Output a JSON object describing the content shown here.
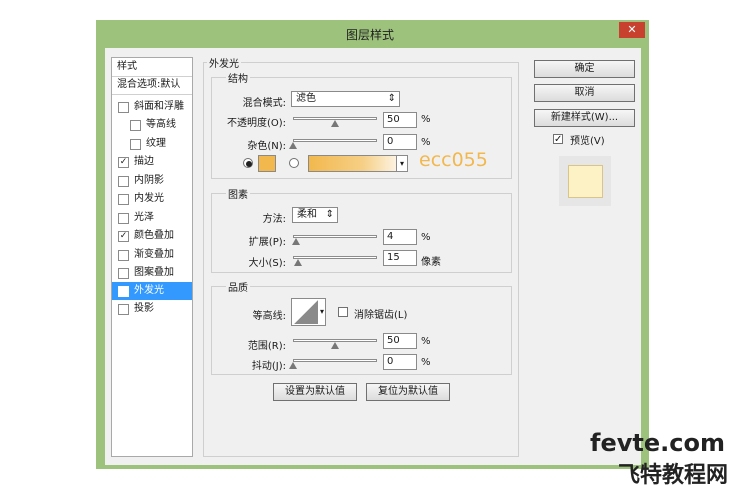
{
  "window": {
    "title": "图层样式",
    "close_glyph": "✕"
  },
  "styles_panel": {
    "header": "样式",
    "items": [
      {
        "label": "混合选项:默认",
        "has_checkbox": false,
        "checked": false,
        "indent": false,
        "selected": false
      },
      {
        "label": "斜面和浮雕",
        "has_checkbox": true,
        "checked": false,
        "indent": false,
        "selected": false
      },
      {
        "label": "等高线",
        "has_checkbox": true,
        "checked": false,
        "indent": true,
        "selected": false
      },
      {
        "label": "纹理",
        "has_checkbox": true,
        "checked": false,
        "indent": true,
        "selected": false
      },
      {
        "label": "描边",
        "has_checkbox": true,
        "checked": true,
        "indent": false,
        "selected": false
      },
      {
        "label": "内阴影",
        "has_checkbox": true,
        "checked": false,
        "indent": false,
        "selected": false
      },
      {
        "label": "内发光",
        "has_checkbox": true,
        "checked": false,
        "indent": false,
        "selected": false
      },
      {
        "label": "光泽",
        "has_checkbox": true,
        "checked": false,
        "indent": false,
        "selected": false
      },
      {
        "label": "颜色叠加",
        "has_checkbox": true,
        "checked": true,
        "indent": false,
        "selected": false
      },
      {
        "label": "渐变叠加",
        "has_checkbox": true,
        "checked": false,
        "indent": false,
        "selected": false
      },
      {
        "label": "图案叠加",
        "has_checkbox": true,
        "checked": false,
        "indent": false,
        "selected": false
      },
      {
        "label": "外发光",
        "has_checkbox": true,
        "checked": true,
        "indent": false,
        "selected": true
      },
      {
        "label": "投影",
        "has_checkbox": true,
        "checked": false,
        "indent": false,
        "selected": false
      }
    ]
  },
  "outer_glow": {
    "section_title": "外发光",
    "structure": {
      "title": "结构",
      "blend_mode_label": "混合模式:",
      "blend_mode_value": "滤色",
      "opacity_label": "不透明度(O):",
      "opacity_value": "50",
      "opacity_level": 0.5,
      "noise_label": "杂色(N):",
      "noise_value": "0",
      "noise_level": 0,
      "percent": "%",
      "color_hex": "#f2b84d",
      "color_code": "ecc055"
    },
    "elements": {
      "title": "图素",
      "technique_label": "方法:",
      "technique_value": "柔和",
      "spread_label": "扩展(P):",
      "spread_value": "4",
      "spread_level": 0.04,
      "size_label": "大小(S):",
      "size_value": "15",
      "size_level": 0.06,
      "percent": "%",
      "pixels": "像素"
    },
    "quality": {
      "title": "品质",
      "contour_label": "等高线:",
      "antialias_label": "消除锯齿(L)",
      "range_label": "范围(R):",
      "range_value": "50",
      "range_level": 0.5,
      "jitter_label": "抖动(J):",
      "jitter_value": "0",
      "jitter_level": 0,
      "percent": "%"
    },
    "make_default": "设置为默认值",
    "reset_default": "复位为默认值"
  },
  "right_panel": {
    "ok": "确定",
    "cancel": "取消",
    "new_style": "新建样式(W)...",
    "preview_label": "预览(V)",
    "preview_checked": true,
    "preview_fill": "#fdf1c6"
  },
  "watermark": {
    "line1": "fevte.com",
    "line2": "飞特教程网"
  }
}
